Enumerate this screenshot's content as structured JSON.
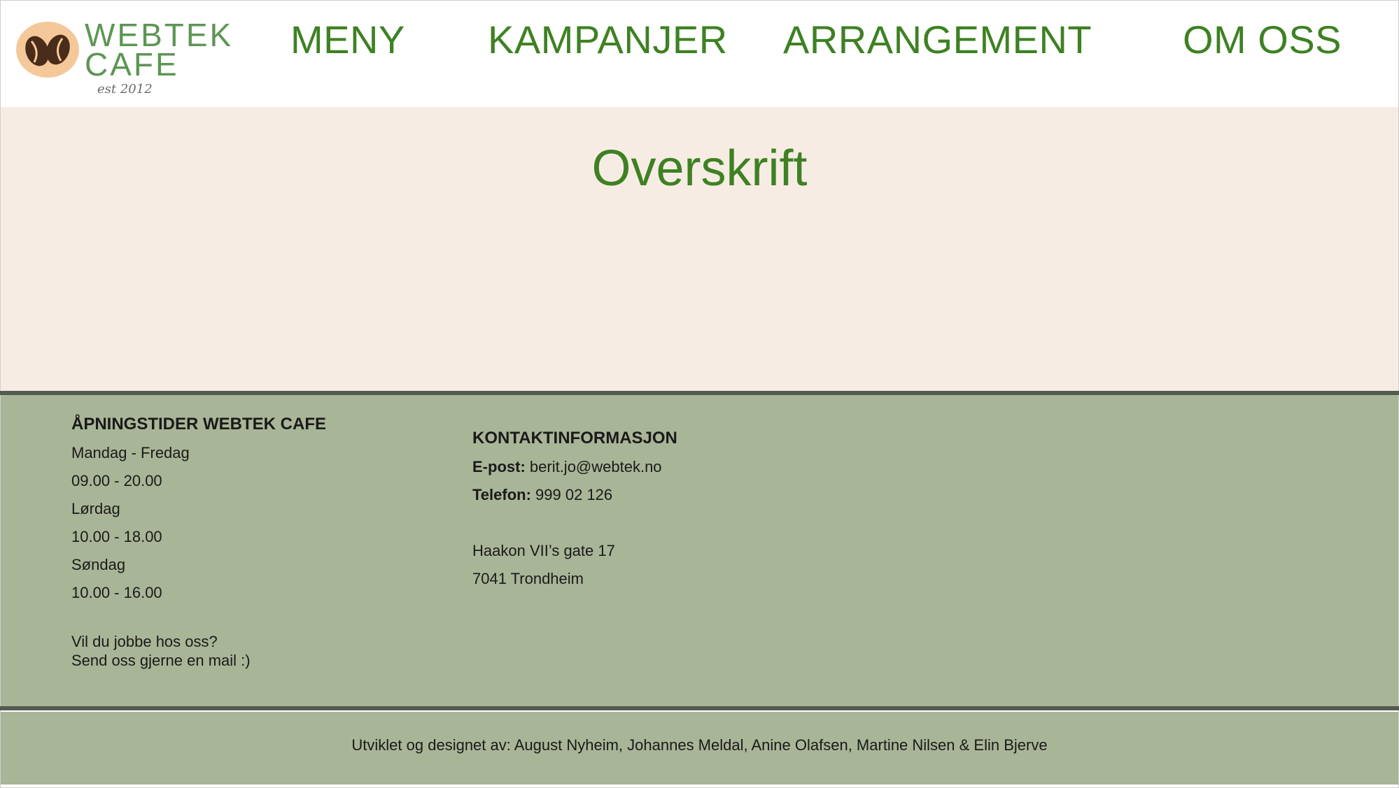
{
  "logo": {
    "line1": "WEBTEK",
    "line2": "CAFE",
    "est": "est 2012",
    "icon": "coffee-beans-icon"
  },
  "nav": {
    "items": [
      "MENY",
      "KAMPANJER",
      "ARRANGEMENT",
      "OM OSS"
    ]
  },
  "hero": {
    "title": "Overskrift"
  },
  "hours": {
    "title": "ÅPNINGSTIDER WEBTEK CAFE",
    "lines": [
      "Mandag - Fredag",
      "09.00 - 20.00",
      "Lørdag",
      "10.00 - 18.00",
      "Søndag",
      "10.00 - 16.00"
    ],
    "jobs_line1": "Vil du jobbe hos oss?",
    "jobs_line2": "Send oss gjerne en mail :)"
  },
  "contact": {
    "title": "KONTAKTINFORMASJON",
    "email_label": "E-post:",
    "email_value": "berit.jo@webtek.no",
    "phone_label": "Telefon:",
    "phone_value": "999 02 126",
    "address_line1": "Haakon VII’s gate 17",
    "address_line2": "7041 Trondheim"
  },
  "credits": "Utviklet og designet av: August Nyheim, Johannes Meldal, Anine Olafsen, Martine Nilsen & Elin Bjerve",
  "colors": {
    "accent": "#3e8123",
    "hero_bg": "#f7ece4",
    "footer_bg": "#a9b597",
    "divider": "#535a52"
  }
}
